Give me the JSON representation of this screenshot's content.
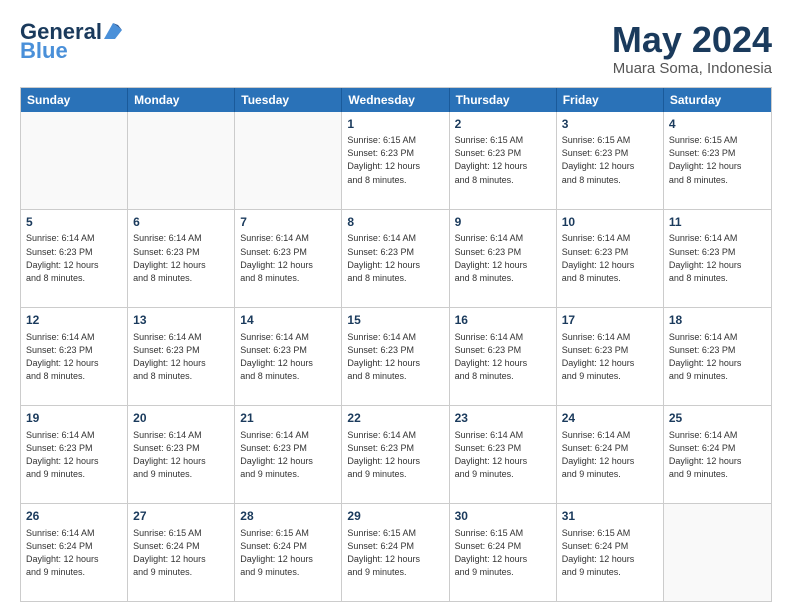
{
  "header": {
    "logo_line1": "General",
    "logo_line2": "Blue",
    "month_title": "May 2024",
    "location": "Muara Soma, Indonesia"
  },
  "days_of_week": [
    "Sunday",
    "Monday",
    "Tuesday",
    "Wednesday",
    "Thursday",
    "Friday",
    "Saturday"
  ],
  "weeks": [
    {
      "cells": [
        {
          "day": "",
          "info": "",
          "empty": true
        },
        {
          "day": "",
          "info": "",
          "empty": true
        },
        {
          "day": "",
          "info": "",
          "empty": true
        },
        {
          "day": "1",
          "info": "Sunrise: 6:15 AM\nSunset: 6:23 PM\nDaylight: 12 hours\nand 8 minutes."
        },
        {
          "day": "2",
          "info": "Sunrise: 6:15 AM\nSunset: 6:23 PM\nDaylight: 12 hours\nand 8 minutes."
        },
        {
          "day": "3",
          "info": "Sunrise: 6:15 AM\nSunset: 6:23 PM\nDaylight: 12 hours\nand 8 minutes."
        },
        {
          "day": "4",
          "info": "Sunrise: 6:15 AM\nSunset: 6:23 PM\nDaylight: 12 hours\nand 8 minutes."
        }
      ]
    },
    {
      "cells": [
        {
          "day": "5",
          "info": "Sunrise: 6:14 AM\nSunset: 6:23 PM\nDaylight: 12 hours\nand 8 minutes."
        },
        {
          "day": "6",
          "info": "Sunrise: 6:14 AM\nSunset: 6:23 PM\nDaylight: 12 hours\nand 8 minutes."
        },
        {
          "day": "7",
          "info": "Sunrise: 6:14 AM\nSunset: 6:23 PM\nDaylight: 12 hours\nand 8 minutes."
        },
        {
          "day": "8",
          "info": "Sunrise: 6:14 AM\nSunset: 6:23 PM\nDaylight: 12 hours\nand 8 minutes."
        },
        {
          "day": "9",
          "info": "Sunrise: 6:14 AM\nSunset: 6:23 PM\nDaylight: 12 hours\nand 8 minutes."
        },
        {
          "day": "10",
          "info": "Sunrise: 6:14 AM\nSunset: 6:23 PM\nDaylight: 12 hours\nand 8 minutes."
        },
        {
          "day": "11",
          "info": "Sunrise: 6:14 AM\nSunset: 6:23 PM\nDaylight: 12 hours\nand 8 minutes."
        }
      ]
    },
    {
      "cells": [
        {
          "day": "12",
          "info": "Sunrise: 6:14 AM\nSunset: 6:23 PM\nDaylight: 12 hours\nand 8 minutes."
        },
        {
          "day": "13",
          "info": "Sunrise: 6:14 AM\nSunset: 6:23 PM\nDaylight: 12 hours\nand 8 minutes."
        },
        {
          "day": "14",
          "info": "Sunrise: 6:14 AM\nSunset: 6:23 PM\nDaylight: 12 hours\nand 8 minutes."
        },
        {
          "day": "15",
          "info": "Sunrise: 6:14 AM\nSunset: 6:23 PM\nDaylight: 12 hours\nand 8 minutes."
        },
        {
          "day": "16",
          "info": "Sunrise: 6:14 AM\nSunset: 6:23 PM\nDaylight: 12 hours\nand 8 minutes."
        },
        {
          "day": "17",
          "info": "Sunrise: 6:14 AM\nSunset: 6:23 PM\nDaylight: 12 hours\nand 9 minutes."
        },
        {
          "day": "18",
          "info": "Sunrise: 6:14 AM\nSunset: 6:23 PM\nDaylight: 12 hours\nand 9 minutes."
        }
      ]
    },
    {
      "cells": [
        {
          "day": "19",
          "info": "Sunrise: 6:14 AM\nSunset: 6:23 PM\nDaylight: 12 hours\nand 9 minutes."
        },
        {
          "day": "20",
          "info": "Sunrise: 6:14 AM\nSunset: 6:23 PM\nDaylight: 12 hours\nand 9 minutes."
        },
        {
          "day": "21",
          "info": "Sunrise: 6:14 AM\nSunset: 6:23 PM\nDaylight: 12 hours\nand 9 minutes."
        },
        {
          "day": "22",
          "info": "Sunrise: 6:14 AM\nSunset: 6:23 PM\nDaylight: 12 hours\nand 9 minutes."
        },
        {
          "day": "23",
          "info": "Sunrise: 6:14 AM\nSunset: 6:23 PM\nDaylight: 12 hours\nand 9 minutes."
        },
        {
          "day": "24",
          "info": "Sunrise: 6:14 AM\nSunset: 6:24 PM\nDaylight: 12 hours\nand 9 minutes."
        },
        {
          "day": "25",
          "info": "Sunrise: 6:14 AM\nSunset: 6:24 PM\nDaylight: 12 hours\nand 9 minutes."
        }
      ]
    },
    {
      "cells": [
        {
          "day": "26",
          "info": "Sunrise: 6:14 AM\nSunset: 6:24 PM\nDaylight: 12 hours\nand 9 minutes."
        },
        {
          "day": "27",
          "info": "Sunrise: 6:15 AM\nSunset: 6:24 PM\nDaylight: 12 hours\nand 9 minutes."
        },
        {
          "day": "28",
          "info": "Sunrise: 6:15 AM\nSunset: 6:24 PM\nDaylight: 12 hours\nand 9 minutes."
        },
        {
          "day": "29",
          "info": "Sunrise: 6:15 AM\nSunset: 6:24 PM\nDaylight: 12 hours\nand 9 minutes."
        },
        {
          "day": "30",
          "info": "Sunrise: 6:15 AM\nSunset: 6:24 PM\nDaylight: 12 hours\nand 9 minutes."
        },
        {
          "day": "31",
          "info": "Sunrise: 6:15 AM\nSunset: 6:24 PM\nDaylight: 12 hours\nand 9 minutes."
        },
        {
          "day": "",
          "info": "",
          "empty": true
        }
      ]
    }
  ]
}
